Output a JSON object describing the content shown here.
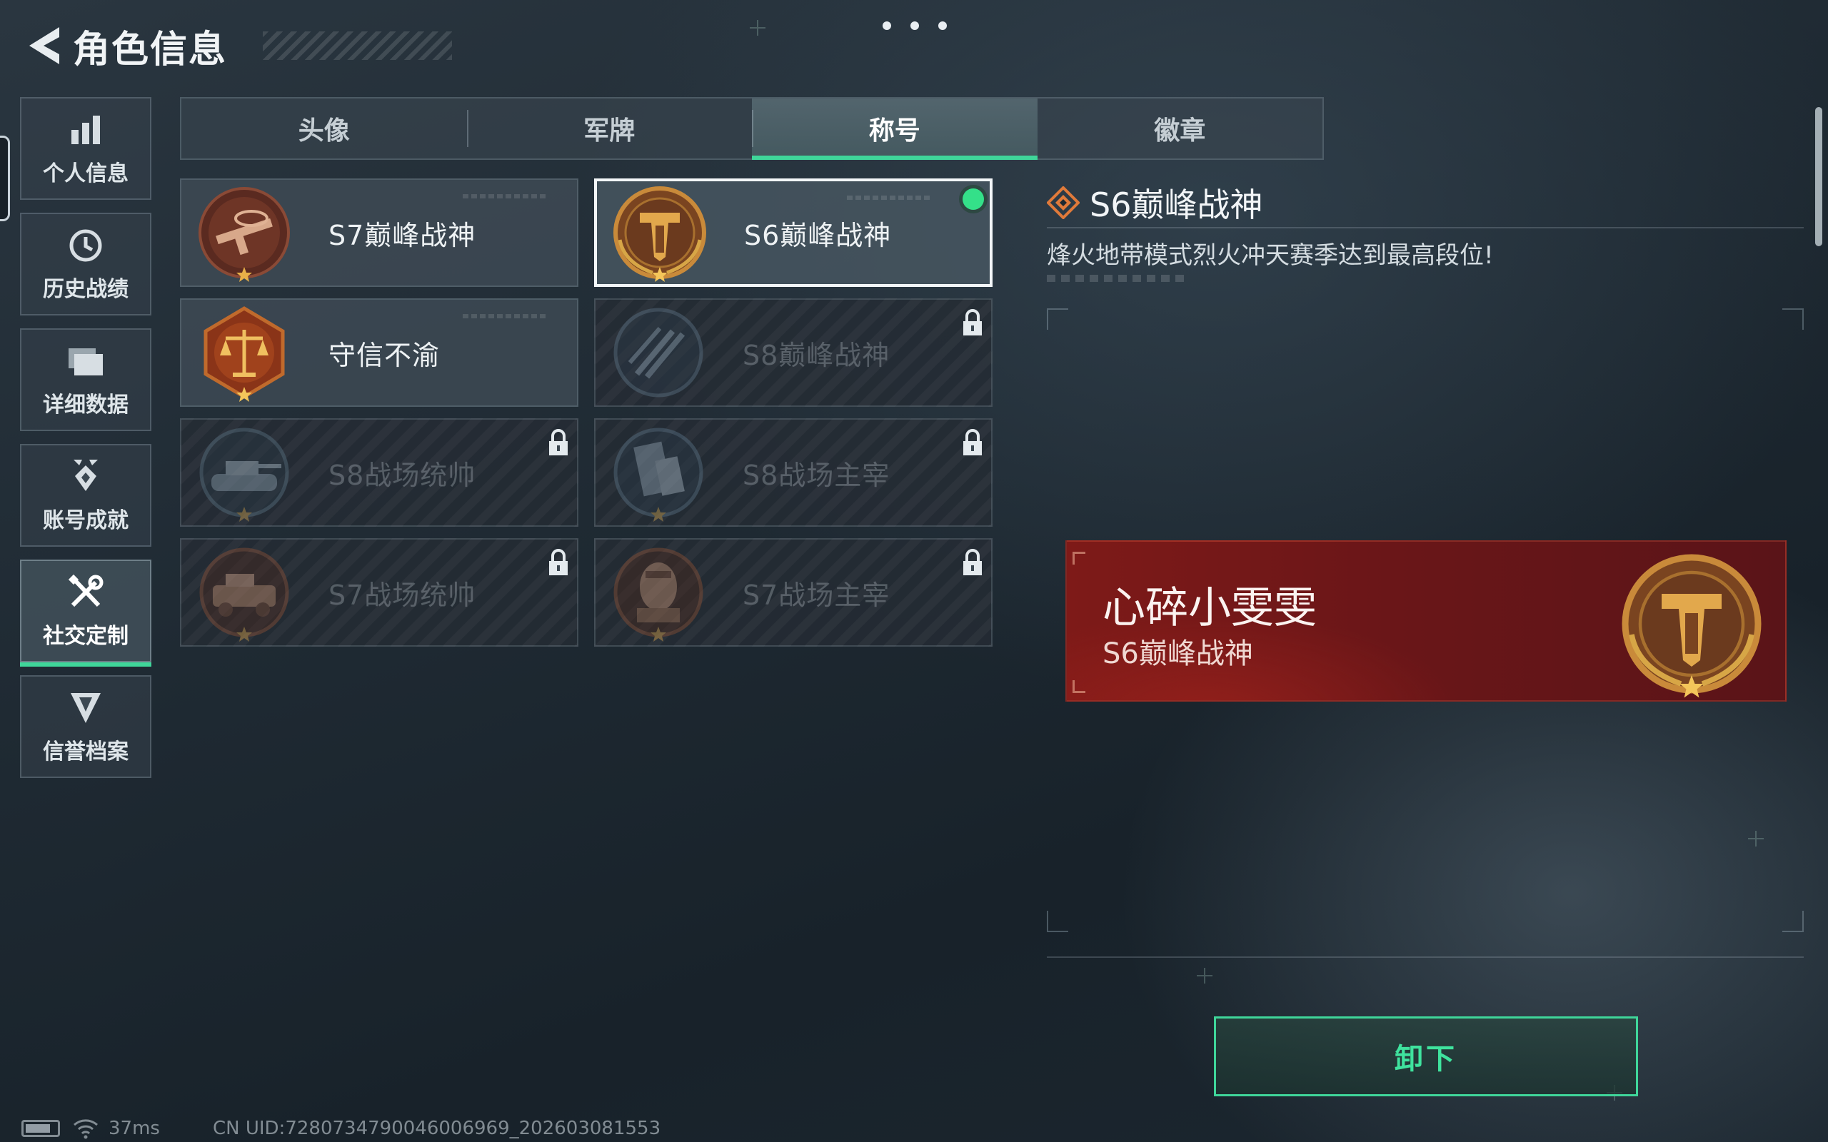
{
  "header": {
    "title": "角色信息"
  },
  "sidebar": {
    "items": [
      {
        "label": "个人信息",
        "icon": "bar-chart-icon"
      },
      {
        "label": "历史战绩",
        "icon": "history-clock-icon"
      },
      {
        "label": "详细数据",
        "icon": "folder-icon"
      },
      {
        "label": "账号成就",
        "icon": "achievement-icon"
      },
      {
        "label": "社交定制",
        "icon": "wrench-screwdriver-icon",
        "active": true
      },
      {
        "label": "信誉档案",
        "icon": "shield-badge-icon"
      }
    ]
  },
  "tabs": [
    {
      "label": "头像"
    },
    {
      "label": "军牌"
    },
    {
      "label": "称号",
      "active": true
    },
    {
      "label": "徽章"
    }
  ],
  "titles": [
    {
      "label": "S7巅峰战神",
      "state": "owned",
      "emblem": "rifle-emblem-icon"
    },
    {
      "label": "S6巅峰战神",
      "state": "equipped",
      "emblem": "golden-t-emblem-icon"
    },
    {
      "label": "守信不渝",
      "state": "owned",
      "emblem": "scales-emblem-icon"
    },
    {
      "label": "S8巅峰战神",
      "state": "locked",
      "emblem": "slash-emblem-icon"
    },
    {
      "label": "S8战场统帅",
      "state": "locked",
      "emblem": "tank-emblem-icon"
    },
    {
      "label": "S8战场主宰",
      "state": "locked",
      "emblem": "building-emblem-icon"
    },
    {
      "label": "S7战场统帅",
      "state": "locked",
      "emblem": "vehicle-emblem-icon"
    },
    {
      "label": "S7战场主宰",
      "state": "locked",
      "emblem": "soldier-emblem-icon"
    }
  ],
  "detail": {
    "title": "S6巅峰战神",
    "description": "烽火地带模式烈火冲天赛季达到最高段位!"
  },
  "nameplate": {
    "player_name": "心碎小雯雯",
    "title": "S6巅峰战神"
  },
  "actions": {
    "unequip_label": "卸下"
  },
  "status": {
    "ping": "37ms",
    "uid": "CN UID:7280734790046006969_202603081553"
  },
  "colors": {
    "accent": "#3fd69a",
    "equipped_dot": "#34e089",
    "nameplate_bg": "#7e1a18",
    "emblem_gold": "#c98a3a"
  }
}
